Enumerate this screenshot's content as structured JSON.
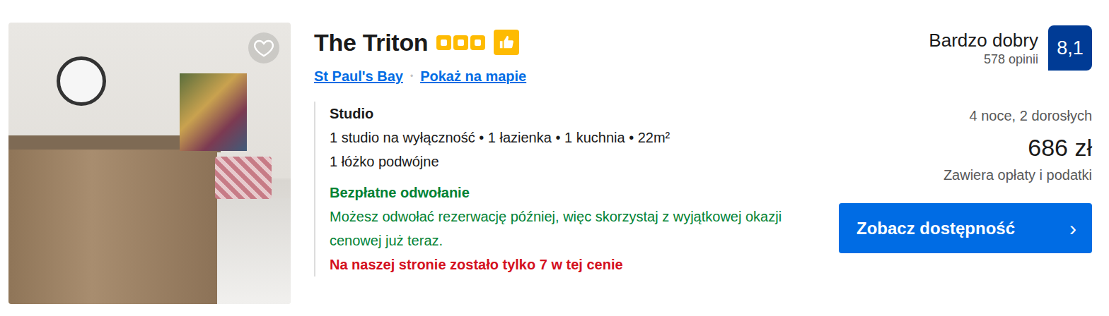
{
  "photo": {
    "favorite": false
  },
  "hotel": {
    "name": "The Triton",
    "stars": 3,
    "preferred": true,
    "location": "St Paul's Bay",
    "link_separator": "•",
    "map_link": "Pokaż na mapie"
  },
  "room": {
    "type": "Studio",
    "details": "1 studio na wyłączność • 1 łazienka • 1 kuchnia • 22m²",
    "bed": "1 łóżko podwójne"
  },
  "cancellation": {
    "title": "Bezpłatne odwołanie",
    "text": "Możesz odwołać rezerwację później, więc skorzystaj z wyjątkowej okazji cenowej już teraz."
  },
  "availability_note": "Na naszej stronie zostało tylko 7 w tej cenie",
  "review": {
    "label": "Bardzo dobry",
    "count": "578 opinii",
    "score": "8,1"
  },
  "price": {
    "stay": "4 noce, 2 dorosłych",
    "amount": "686 zł",
    "note": "Zawiera opłaty i podatki"
  },
  "button": {
    "label": "Zobacz dostępność",
    "arrow": "›"
  }
}
